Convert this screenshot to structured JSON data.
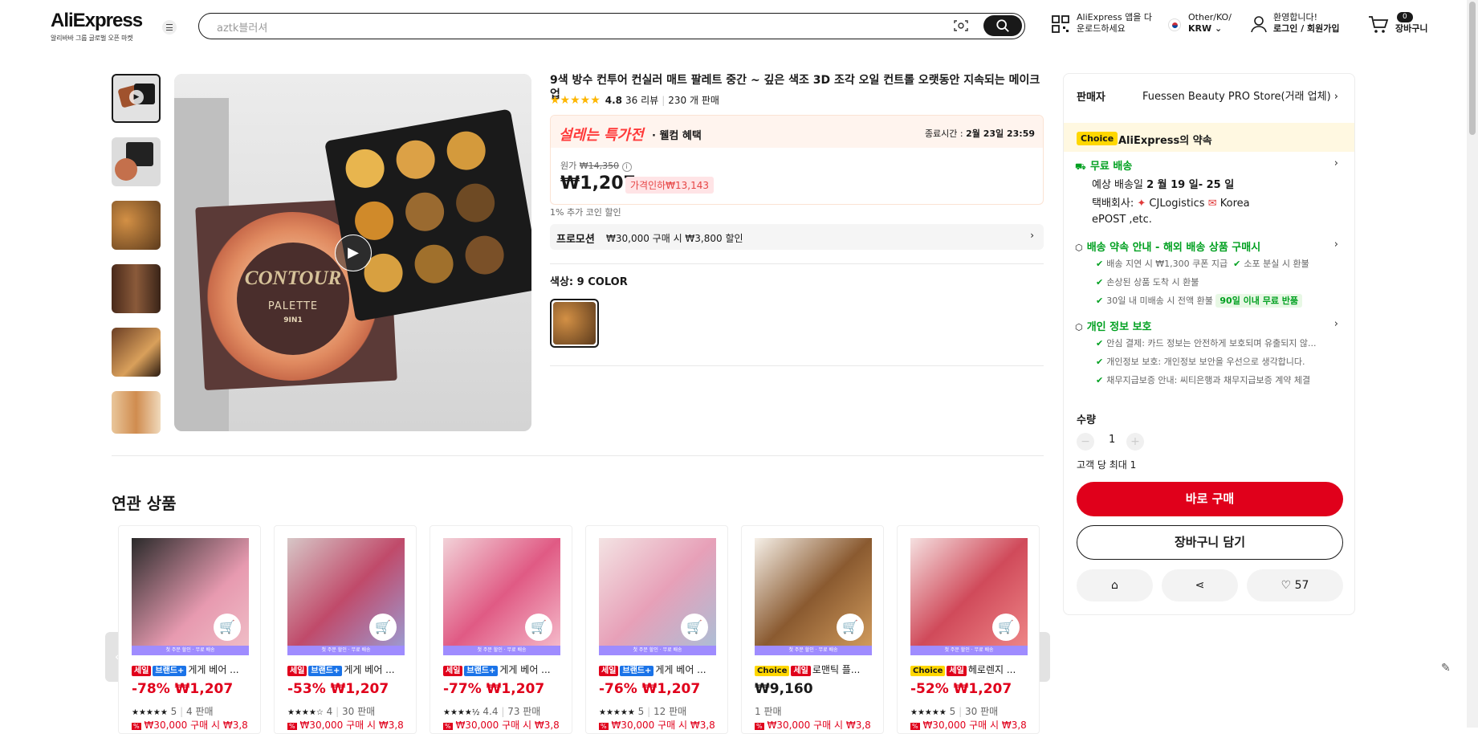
{
  "header": {
    "logo": "AliExpress",
    "logo_sub": "알리바바 그룹 글로벌 오픈 마켓",
    "search_placeholder": "aztk블러셔",
    "app_label_1": "AliExpress 앱을 다",
    "app_label_2": "운로드하세요",
    "region_1": "Other/KO/",
    "region_2": "KRW",
    "account_1": "환영합니다!",
    "account_2": "로그인 / 회원가입",
    "cart_count": "0",
    "cart_label": "장바구니"
  },
  "product": {
    "title": "9색 방수 컨투어 컨실러 매트 팔레트 중간 ~ 깊은 색조 3D 조각 오일 컨트롤 오랫동안 지속되는 메이크업",
    "rating": "4.8",
    "reviews": "36 리뷰",
    "sold": "230 개 판매",
    "deal_brand": "설레는 특가전",
    "deal_sub": "· 웰컴 혜택",
    "deal_end_label": "종료시간 :",
    "deal_end": "2월 23일 23:59",
    "orig_label": "원가",
    "orig_price": "₩14,350",
    "price": "₩1,207",
    "discount_badge": "가격인하₩13,143",
    "coin": "1% 추가 코인 할인",
    "promo_label": "프로모션",
    "promo_text": "₩30,000 구매 시 ₩3,800 할인",
    "color_label": "색상:",
    "color_value": "9 COLOR",
    "main_image_text_1": "CONTOUR",
    "main_image_text_2": "PALETTE",
    "main_image_text_3": "9IN1"
  },
  "panel": {
    "seller_label": "판매자",
    "store": "Fuessen Beauty PRO Store(거래 업체)",
    "choice": "Choice",
    "choice_text": "AliExpress의 약속",
    "free_ship": "무료 배송",
    "est_label": "예상 배송일",
    "est_date": "2 월 19 일- 25 일",
    "carrier_label": "택배회사:",
    "carrier_1": "CJLogistics",
    "carrier_2": "Korea",
    "carrier_3": "ePOST ,etc.",
    "promise_title": "배송 약속 안내 - 해외 배송 상품 구매시",
    "promise_1": "배송 지연 시 ₩1,300 쿠폰 지급",
    "promise_2": "소포 분실 시 환불",
    "promise_3": "손상된 상품 도착 시 환불",
    "promise_4": "30일 내 미배송 시 전액 환불",
    "promise_tag": "90일 이내 무료 반품",
    "privacy_title": "개인 정보 보호",
    "privacy_1": "안심 결제: 카드 정보는 안전하게 보호되며 유출되지 않...",
    "privacy_2": "개인정보 보호: 개인정보 보안을 우선으로 생각합니다.",
    "privacy_3": "채무지급보증 안내: 씨티은행과 채무지급보증 계약 체결",
    "qty_label": "수량",
    "qty": "1",
    "qty_max": "고객 당 최대 1",
    "buy": "바로 구매",
    "add_cart": "장바구니 담기",
    "likes": "57"
  },
  "related": {
    "title": "연관 상품",
    "strip": "첫 주문 할인 · 무료 배송",
    "sale_tag": "세일",
    "brand_tag": "브랜드+",
    "choice_tag": "Choice",
    "items": [
      {
        "name": "게게 베어 ...",
        "disc": "-78%",
        "price": "₩1,207",
        "stars": "★★★★★",
        "rating": "5",
        "sold": "4 판매",
        "promo": "₩30,000 구매 시 ₩3,8"
      },
      {
        "name": "게게 베어 ...",
        "disc": "-53%",
        "price": "₩1,207",
        "stars": "★★★★☆",
        "rating": "4",
        "sold": "30 판매",
        "promo": "₩30,000 구매 시 ₩3,8"
      },
      {
        "name": "게게 베어 ...",
        "disc": "-77%",
        "price": "₩1,207",
        "stars": "★★★★½",
        "rating": "4.4",
        "sold": "73 판매",
        "promo": "₩30,000 구매 시 ₩3,8"
      },
      {
        "name": "게게 베어 ...",
        "disc": "-76%",
        "price": "₩1,207",
        "stars": "★★★★★",
        "rating": "5",
        "sold": "12 판매",
        "promo": "₩30,000 구매 시 ₩3,8"
      },
      {
        "name": "로맨틱 플...",
        "disc": "",
        "price": "₩9,160",
        "stars": "",
        "rating": "",
        "sold": "1 판매",
        "promo": "₩30,000 구매 시 ₩3,8"
      },
      {
        "name": "헤로렌지 ...",
        "disc": "-52%",
        "price": "₩1,207",
        "stars": "★★★★★",
        "rating": "5",
        "sold": "30 판매",
        "promo": "₩30,000 구매 시 ₩3,8"
      }
    ]
  },
  "colors": {
    "accent": "#e0001b",
    "deal_red": "#ff3a3a",
    "green": "#00a020",
    "star": "#fdb600"
  }
}
